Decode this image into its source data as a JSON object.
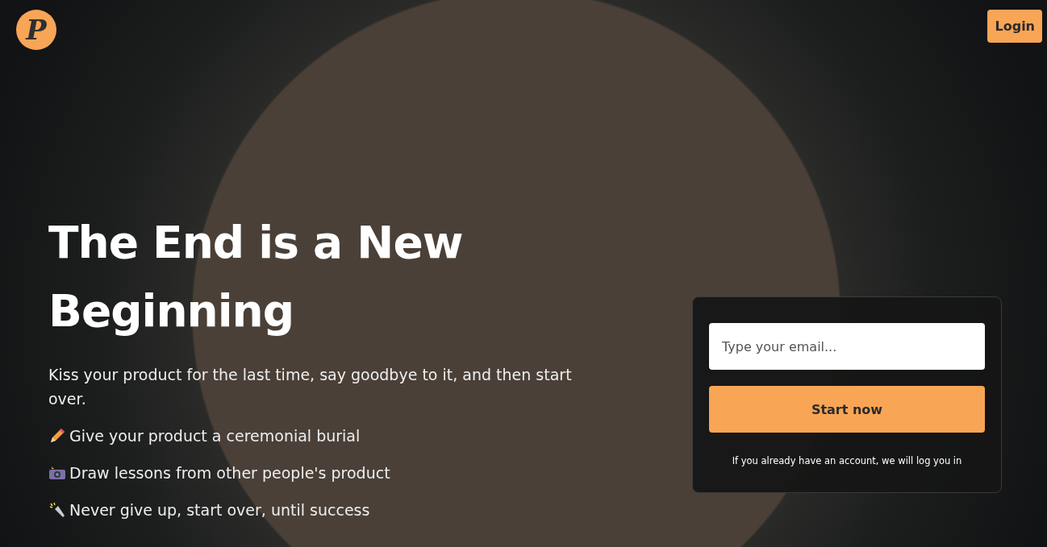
{
  "header": {
    "logo": "P",
    "login": "Login"
  },
  "hero": {
    "title": "The End is a New Beginning",
    "subtitle": "Kiss your product for the last time, say goodbye to it, and then start over.",
    "features": [
      {
        "kind": "pencil",
        "text": "Give your product a ceremonial burial"
      },
      {
        "kind": "camera",
        "text": "Draw lessons from other people's product"
      },
      {
        "kind": "flashlight",
        "text": "Never give up, start over, until success"
      }
    ]
  },
  "signup": {
    "placeholder": "Type your email...",
    "button": "Start now",
    "note": "If you already have an account, we will log you in"
  }
}
